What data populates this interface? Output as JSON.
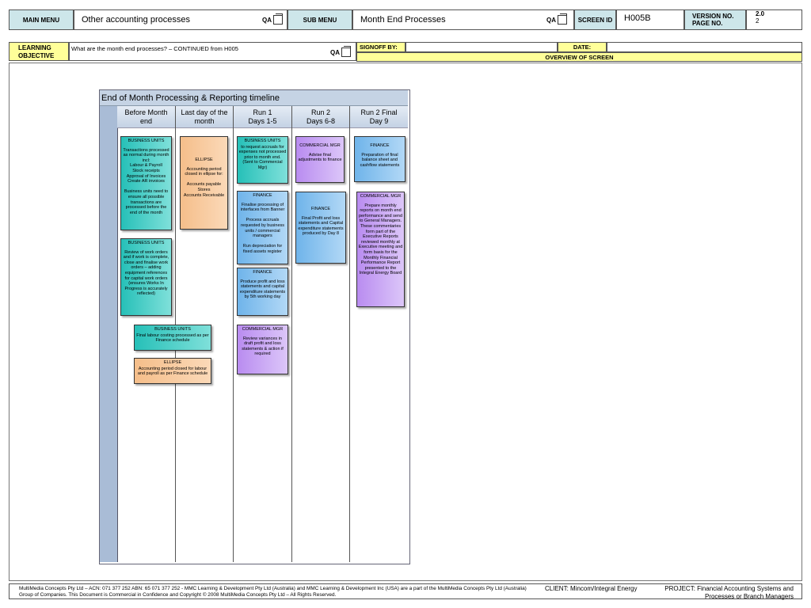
{
  "header": {
    "main_menu_label": "MAIN MENU",
    "main_menu_value": "Other accounting processes",
    "qa_label": "QA",
    "sub_menu_label": "SUB MENU",
    "sub_menu_value": "Month End Processes",
    "screen_id_label": "SCREEN ID",
    "screen_id_value": "H005B",
    "version_label": "VERSION NO.",
    "page_label": "PAGE NO.",
    "version_value": "2.0",
    "page_value": "2"
  },
  "learning": {
    "label_line1": "LEARNING",
    "label_line2": "OBJECTIVE",
    "text": "What are the month end processes? – CONTINUED from H005",
    "signoff_label": "SIGNOFF BY:",
    "date_label": "DATE:",
    "overview_label": "OVERVIEW OF SCREEN"
  },
  "diagram": {
    "title": "End of Month Processing & Reporting timeline",
    "columns": [
      {
        "line1": "Before Month",
        "line2": "end"
      },
      {
        "line1": "Last day of the",
        "line2": "month"
      },
      {
        "line1": "Run 1",
        "line2": "Days 1-5"
      },
      {
        "line1": "Run 2",
        "line2": "Days 6-8"
      },
      {
        "line1": "Run 2 Final",
        "line2": "Day 9"
      }
    ],
    "boxes": [
      {
        "head": "BUSINESS UNITS",
        "body": "Transactions processed as normal during month incl:\nLabour & Payroll\nStock receipts\nApproval of Invoices\nCreate AR invoices\n\nBusiness units need to ensure all possible transactions are processed before the end of the month"
      },
      {
        "head": "BUSINESS UNITS",
        "body": "Review of work orders and if work is complete, close and finalise work orders – adding equipment references for capital work orders\n(ensures Works In Progress is accurately reflected)"
      },
      {
        "head": "BUSINESS UNITS",
        "body": "Final labour costing processed as per Finance schedule"
      },
      {
        "head": "ELLIPSE",
        "body": "Accounting period closed for labour and payroll as per Finance schedule"
      },
      {
        "head": "ELLIPSE",
        "body": "Accounting period closed in ellipse for:\n\nAccounts payable\nStores\nAccounts Receivable"
      },
      {
        "head": "BUSINESS UNITS",
        "body": "to request accruals for expenses not processed prior to month end.\n(Sent to Commercial Mgr)"
      },
      {
        "head": "FINANCE",
        "body": "Finalise processing of interfaces from Banner\n\nProcess accruals requested by business units / commercial managers\n\nRun depreciation for fixed assets register"
      },
      {
        "head": "FINANCE",
        "body": "Produce profit and loss statements and capital expenditure statements by 5th working day"
      },
      {
        "head": "COMMERCIAL MGR",
        "body": "Review variances in draft profit and loss statements & action if required"
      },
      {
        "head": "COMMERCIAL MGR",
        "body": "Advise final adjustments to finance"
      },
      {
        "head": "FINANCE",
        "body": "Final Profit and loss statements and Capital expenditure statements produced by Day 8"
      },
      {
        "head": "FINANCE",
        "body": "Preparation of final balance sheet and cashflow statements"
      },
      {
        "head": "COMMERCIAL MGR",
        "body": "Prepare monthly reports on month end performance and send to General Managers. These commentaries form part of the Executive Reports reviewed monthly at Executive meeting and form basis for the Monthly Financial Performance Report presented to the Integral Energy Board"
      }
    ]
  },
  "footer": {
    "copyright": "MultiMedia Concepts Pty Ltd – ACN: 071 377 252   ABN: 65 071 377 252 - MMC Learning & Development Pty Ltd (Australia) and MMC Learning & Development Inc (USA) are a part of the MultiMedia Concepts Pty Ltd (Australia) Group of Companies.   This Document is Commercial in Confidence and Copyright © 2008 MultiMedia Concepts Pty Ltd – All Rights Reserved.",
    "client": "CLIENT:  Mincom/Integral Energy",
    "project": "PROJECT: Financial Accounting Systems and Processes or Branch Managers"
  },
  "colors": {
    "header_teal": "#cde6ea",
    "yellow": "#ffff99",
    "business_units": "#26c0b8",
    "ellipse": "#f5be8a",
    "finance": "#6fb4ea",
    "commercial_mgr": "#b98cf0"
  }
}
